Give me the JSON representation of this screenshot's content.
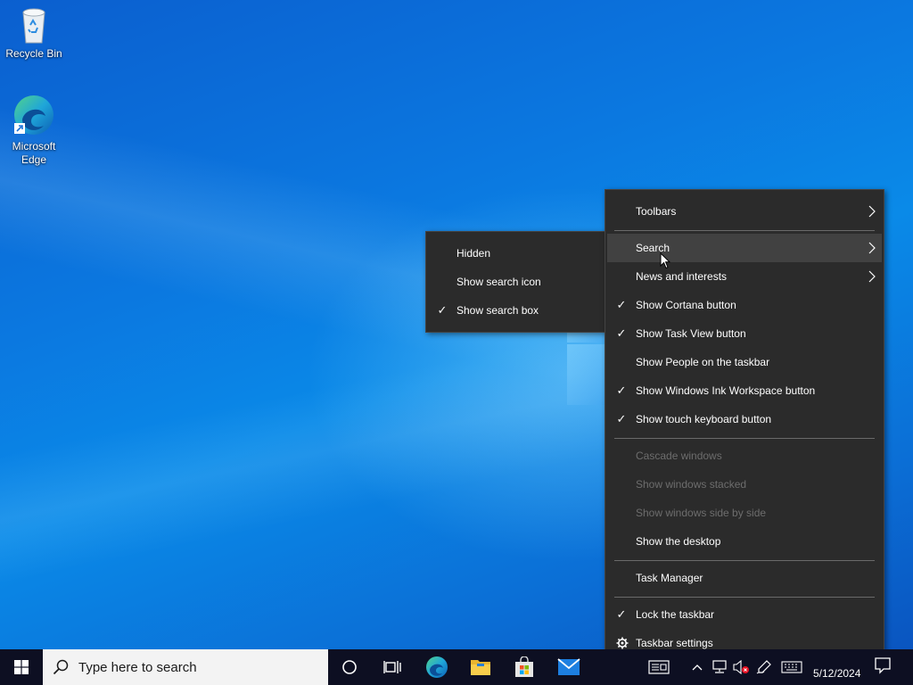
{
  "desktop": {
    "icons": [
      {
        "label": "Recycle Bin",
        "icon": "recycle-bin-icon"
      },
      {
        "label": "Microsoft Edge",
        "icon": "edge-icon"
      }
    ]
  },
  "context_menu": {
    "items": [
      {
        "label": "Toolbars",
        "checked": false,
        "submenu": true
      },
      {
        "label": "Search",
        "checked": false,
        "submenu": true,
        "highlighted": true
      },
      {
        "label": "News and interests",
        "checked": false,
        "submenu": true
      },
      {
        "label": "Show Cortana button",
        "checked": true
      },
      {
        "label": "Show Task View button",
        "checked": true
      },
      {
        "label": "Show People on the taskbar",
        "checked": false
      },
      {
        "label": "Show Windows Ink Workspace button",
        "checked": true
      },
      {
        "label": "Show touch keyboard button",
        "checked": true
      },
      {
        "label": "Cascade windows",
        "disabled": true
      },
      {
        "label": "Show windows stacked",
        "disabled": true
      },
      {
        "label": "Show windows side by side",
        "disabled": true
      },
      {
        "label": "Show the desktop"
      },
      {
        "label": "Task Manager"
      },
      {
        "label": "Lock the taskbar",
        "checked": true
      },
      {
        "label": "Taskbar settings",
        "icon": "gear-icon"
      }
    ],
    "check_glyph": "✓"
  },
  "search_submenu": {
    "items": [
      {
        "label": "Hidden",
        "checked": false
      },
      {
        "label": "Show search icon",
        "checked": false
      },
      {
        "label": "Show search box",
        "checked": true
      }
    ]
  },
  "taskbar": {
    "search_placeholder": "Type here to search",
    "pinned": [
      "cortana-icon",
      "task-view-icon",
      "edge-icon",
      "file-explorer-icon",
      "microsoft-store-icon",
      "mail-icon"
    ],
    "tray_icons": [
      "news-icon",
      "show-hidden-icons-chevron",
      "network-icon",
      "volume-muted-icon",
      "windows-ink-icon",
      "touch-keyboard-icon"
    ],
    "date": "5/12/2024"
  },
  "colors": {
    "menu_bg": "#2b2b2b",
    "menu_highlight": "#414141",
    "taskbar_bg": "#0d0f22",
    "disabled_text": "#6d6d6d"
  }
}
